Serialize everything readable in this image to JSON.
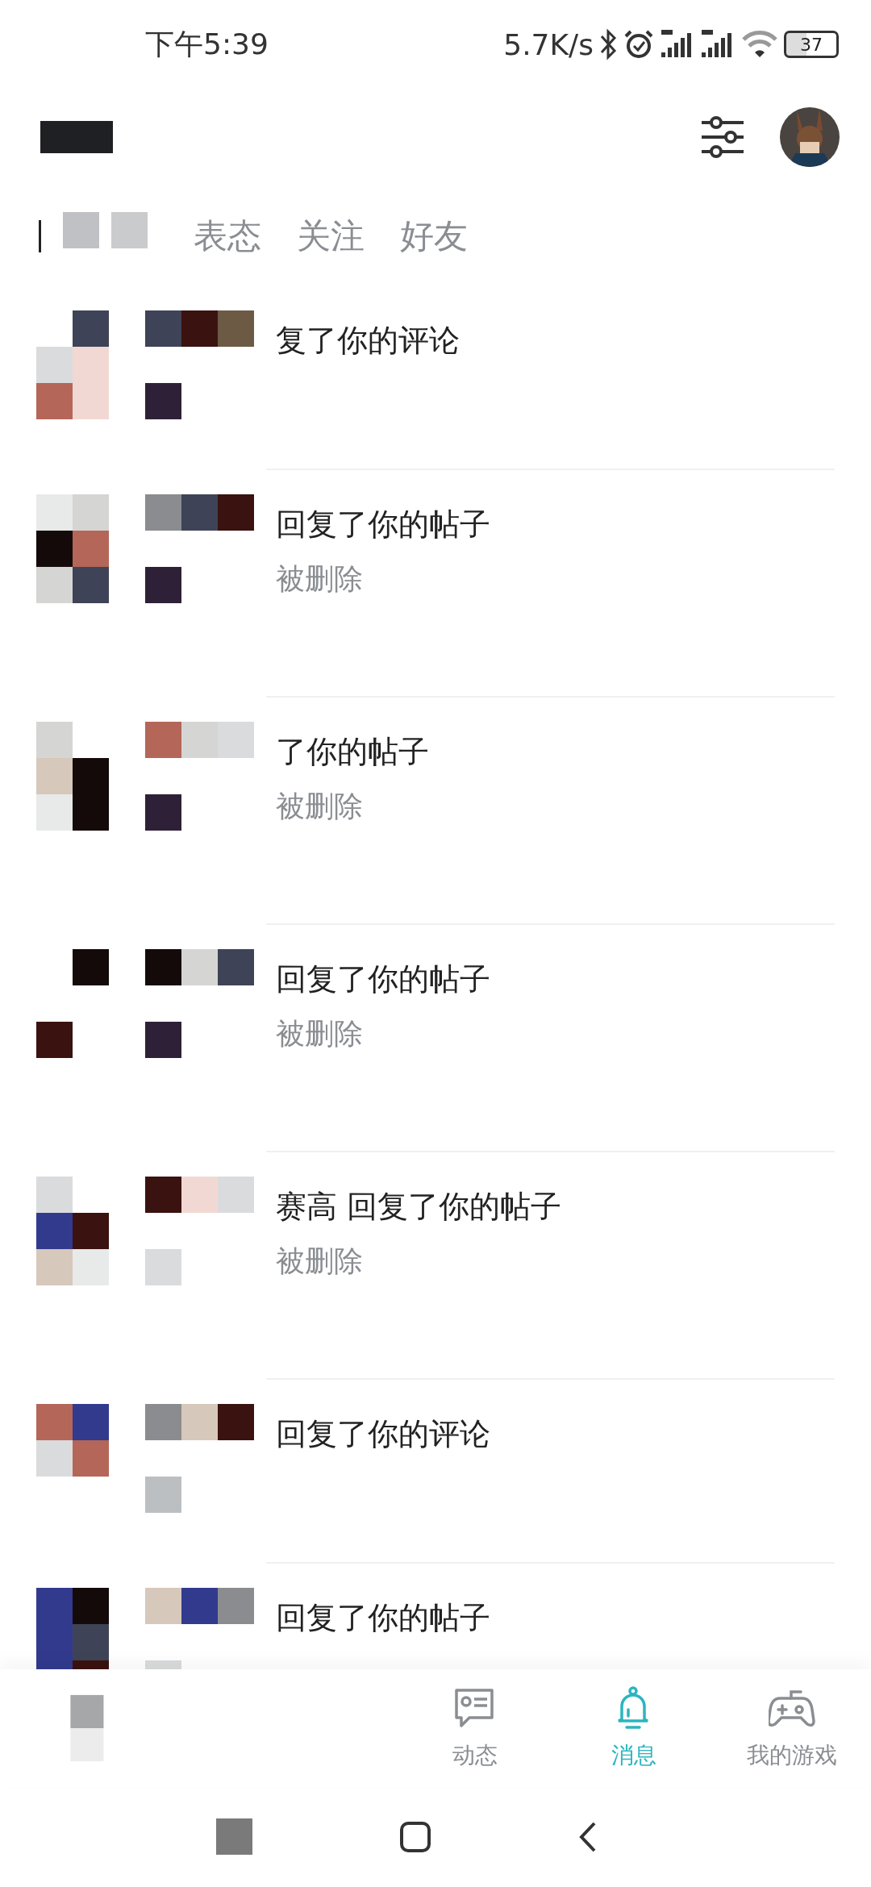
{
  "status_bar": {
    "time": "下午5:39",
    "speed": "5.7K/s",
    "battery": "37"
  },
  "tabs": [
    {
      "label": "表态",
      "selected": false
    },
    {
      "label": "关注",
      "selected": false
    },
    {
      "label": "好友",
      "selected": false
    }
  ],
  "messages": [
    {
      "title": "复了你的评论"
    },
    {
      "title": "回复了你的帖子",
      "subtitle": "被删除"
    },
    {
      "title": "了你的帖子",
      "subtitle": "被删除"
    },
    {
      "title": "回复了你的帖子",
      "subtitle": "被删除"
    },
    {
      "title": "赛高 回复了你的帖子",
      "subtitle": "被删除"
    },
    {
      "title": "回复了你的评论"
    },
    {
      "title": "回复了你的帖子"
    }
  ],
  "bottom_nav": [
    {
      "label": "动态",
      "selected": false
    },
    {
      "label": "消息",
      "selected": true
    },
    {
      "label": "我的游戏",
      "selected": false
    }
  ]
}
